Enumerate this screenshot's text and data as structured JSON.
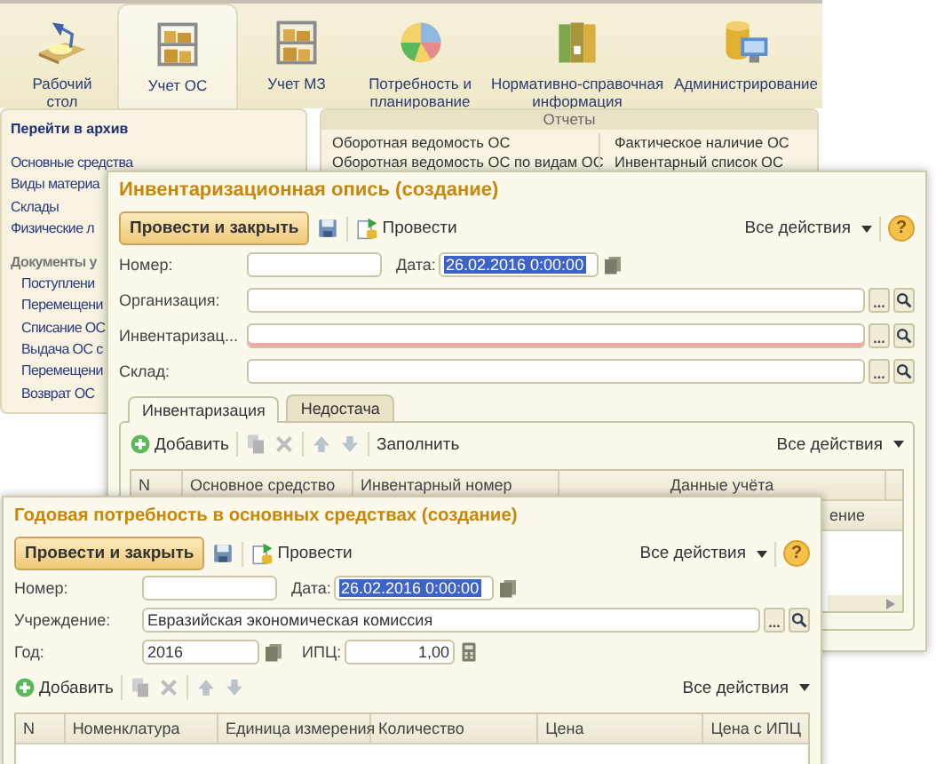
{
  "app": {
    "sections": [
      {
        "label": "Рабочий\nстол",
        "selected": false
      },
      {
        "label": "Учет ОС",
        "selected": true
      },
      {
        "label": "Учет МЗ",
        "selected": false
      },
      {
        "label": "Потребность и\nпланирование",
        "selected": false
      },
      {
        "label": "Нормативно-справочная\nинформация",
        "selected": false
      },
      {
        "label": "Администрирование",
        "selected": false
      }
    ]
  },
  "navigation": {
    "archive_link": "Перейти в архив",
    "catalogs": [
      "Основные средства",
      "Виды материа",
      "Склады",
      "Физические л"
    ],
    "documents_heading": "Документы у",
    "documents": [
      "Поступлени",
      "Перемещени",
      "Списание ОС",
      "Выдача ОС с",
      "Перемещени",
      "Возврат ОС"
    ]
  },
  "reports": {
    "title": "Отчеты",
    "column_1": [
      "Оборотная ведомость ОС",
      "Оборотная ведомость ОС по видам ОС"
    ],
    "column_2": [
      "Фактическое наличие ОС",
      "Инвентарный список ОС"
    ]
  },
  "inventory_form": {
    "title": "Инвентаризационная опись (создание)",
    "toolbar": {
      "post_close": "Провести и закрыть",
      "post": "Провести",
      "all_actions": "Все действия",
      "help": "?"
    },
    "number": {
      "label": "Номер:"
    },
    "date": {
      "label": "Дата:",
      "value": "26.02.2016 0:00:00",
      "value_selected": true
    },
    "fields": [
      {
        "label": "Организация:",
        "required": false,
        "choice_button": "..."
      },
      {
        "label": "Инвентаризац...",
        "required": true,
        "choice_button": "..."
      },
      {
        "label": "Склад:",
        "required": false,
        "choice_button": "..."
      }
    ],
    "tabs": [
      {
        "label": "Инвентаризация",
        "selected": true
      },
      {
        "label": "Недостача",
        "selected": false
      }
    ],
    "table_toolbar": {
      "add": "Добавить",
      "fill": "Заполнить",
      "all_actions": "Все действия"
    },
    "columns": [
      "N",
      "Основное средство",
      "Инвентарный номер",
      "Данные учёта"
    ],
    "subheader_tail": "ение"
  },
  "annual_form": {
    "title": "Годовая потребность в основных средствах (создание)",
    "toolbar": {
      "post_close": "Провести и закрыть",
      "post": "Провести",
      "all_actions": "Все действия",
      "help": "?"
    },
    "number": {
      "label": "Номер:"
    },
    "date": {
      "label": "Дата:",
      "value": "26.02.2016 0:00:00",
      "value_selected": true
    },
    "institution": {
      "label": "Учреждение:",
      "value": "Евразийская экономическая комиссия",
      "choice_button": "..."
    },
    "year": {
      "label": "Год:",
      "value": "2016"
    },
    "cpi": {
      "label": "ИПЦ:",
      "value": "1,00"
    },
    "table_toolbar": {
      "add": "Добавить",
      "all_actions": "Все действия"
    },
    "columns": [
      "N",
      "Номенклатура",
      "Единица измерения",
      "Количество",
      "Цена",
      "Цена с ИПЦ"
    ]
  }
}
